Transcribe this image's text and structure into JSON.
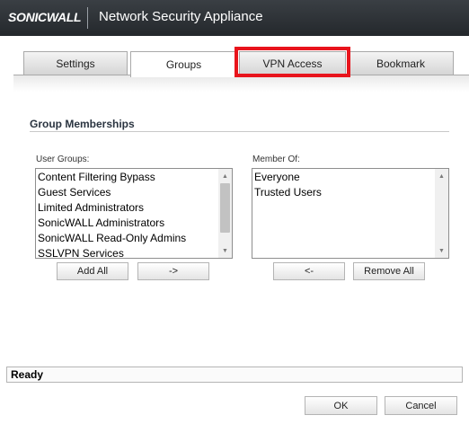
{
  "header": {
    "logo": "SONICWALL",
    "title": "Network Security Appliance"
  },
  "tabs": [
    {
      "label": "Settings"
    },
    {
      "label": "Groups",
      "active": true
    },
    {
      "label": "VPN Access",
      "highlighted": true
    },
    {
      "label": "Bookmark"
    }
  ],
  "section": {
    "title": "Group Memberships"
  },
  "user_groups": {
    "label": "User Groups:",
    "items": [
      "Content Filtering Bypass",
      "Guest Services",
      "Limited Administrators",
      "SonicWALL Administrators",
      "SonicWALL Read-Only Admins",
      "SSLVPN Services"
    ]
  },
  "member_of": {
    "label": "Member Of:",
    "items": [
      "Everyone",
      "Trusted Users"
    ]
  },
  "buttons": {
    "add_all": "Add All",
    "add": "->",
    "remove": "<-",
    "remove_all": "Remove All",
    "ok": "OK",
    "cancel": "Cancel"
  },
  "status": {
    "text": "Ready"
  },
  "colors": {
    "header_bg": "#2e3338",
    "highlight": "#e8141c"
  },
  "icons": {
    "scroll_up": "triangle-up",
    "scroll_down": "triangle-down"
  }
}
